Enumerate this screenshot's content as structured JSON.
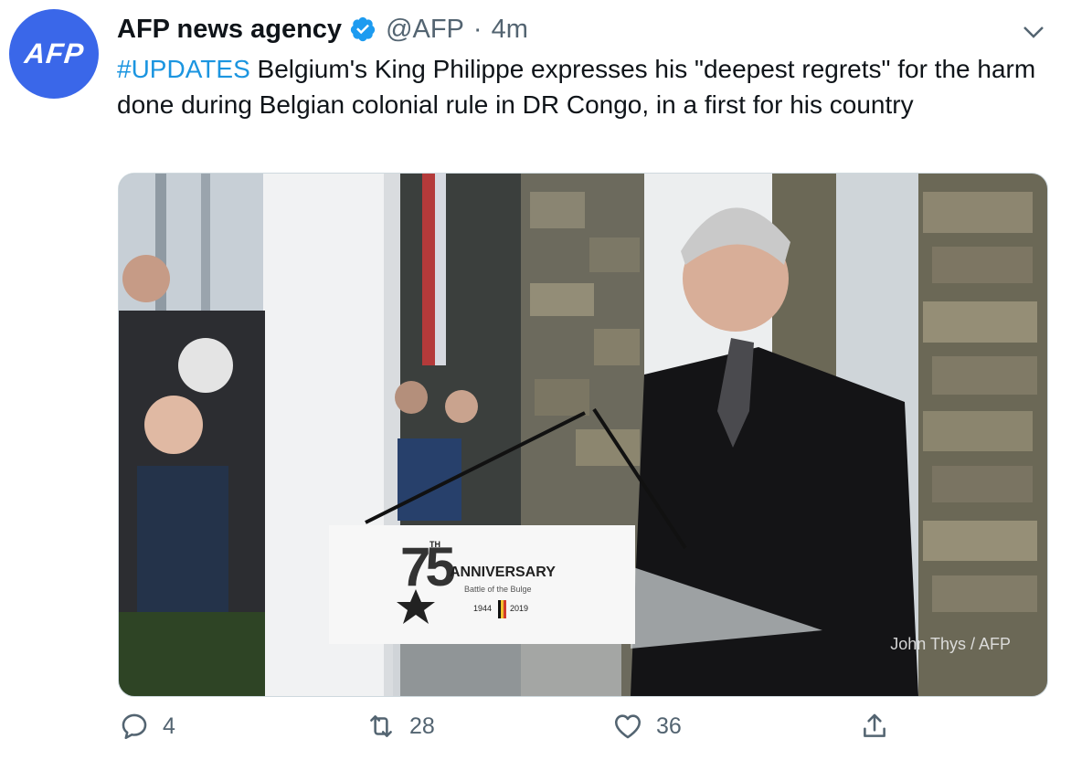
{
  "tweet": {
    "avatar_text": "AFP",
    "author_name": "AFP news agency",
    "handle": "@AFP",
    "separator": "·",
    "time": "4m",
    "hashtag": "#UPDATES",
    "body": " Belgium's King Philippe expresses his \"deepest regrets\" for the harm done during Belgian colonial rule in DR Congo, in a first for his country"
  },
  "media": {
    "photo_credit": "John Thys / AFP",
    "podium": {
      "number": "75",
      "superscript": "TH",
      "title": "ANNIVERSARY",
      "subtitle": "Battle of the Bulge",
      "year_start": "1944",
      "year_end": "2019"
    }
  },
  "actions": {
    "reply_count": "4",
    "retweet_count": "28",
    "like_count": "36"
  },
  "icons": {
    "verified": "verified-badge-icon",
    "more": "chevron-down-icon",
    "reply": "reply-icon",
    "retweet": "retweet-icon",
    "like": "heart-icon",
    "share": "share-icon"
  },
  "colors": {
    "brand_blue": "#3a67e9",
    "link": "#1b95e0",
    "muted": "#536471"
  }
}
